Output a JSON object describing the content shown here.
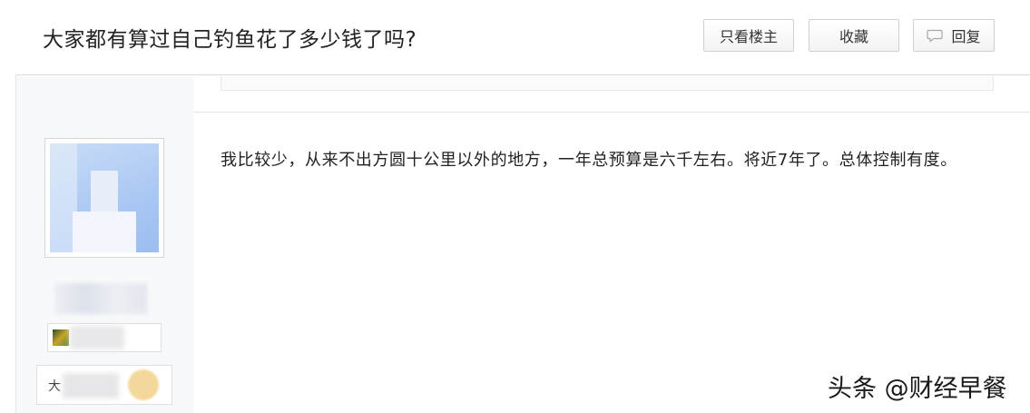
{
  "thread": {
    "title": "大家都有算过自己钓鱼花了多少钱了吗?"
  },
  "actions": {
    "only_author": "只看楼主",
    "favorite": "收藏",
    "reply": "回复"
  },
  "post": {
    "content": "我比较少，从来不出方圆十公里以外的地方，一年总预算是六千左右。将近7年了。总体控制有度。"
  },
  "author": {
    "badge_prefix": "大"
  },
  "watermark": {
    "text": "头条 @财经早餐"
  },
  "icons": {
    "reply": "speech-bubble-icon"
  },
  "colors": {
    "sidebar_bg": "#f7f8fa",
    "border": "#d9d9d9"
  }
}
